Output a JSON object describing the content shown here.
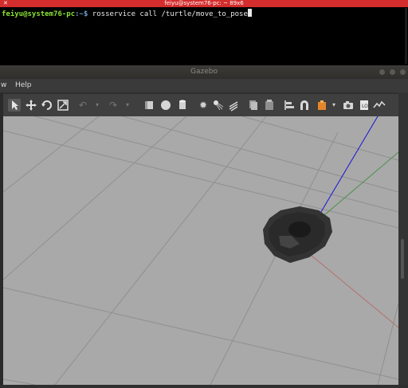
{
  "terminal": {
    "title": "feiyu@system76-pc: ~ 89x6",
    "prompt_user": "feiyu@system76-pc",
    "prompt_path": ":~$",
    "command": " rosservice call /turtle/move_to_pose"
  },
  "gazebo": {
    "window_title": "Gazebo",
    "menu": {
      "view_partial": "w",
      "help": "Help"
    },
    "toolbar_icons": [
      "select-arrow-icon",
      "translate-icon",
      "rotate-icon",
      "scale-icon",
      "undo-icon",
      "redo-icon",
      "box-icon",
      "sphere-icon",
      "cylinder-icon",
      "point-light-icon",
      "spot-light-icon",
      "directional-light-icon",
      "copy-icon",
      "paste-icon",
      "align-icon",
      "magnet-icon",
      "change-view-icon",
      "screenshot-icon",
      "log-icon",
      "plot-icon"
    ]
  }
}
